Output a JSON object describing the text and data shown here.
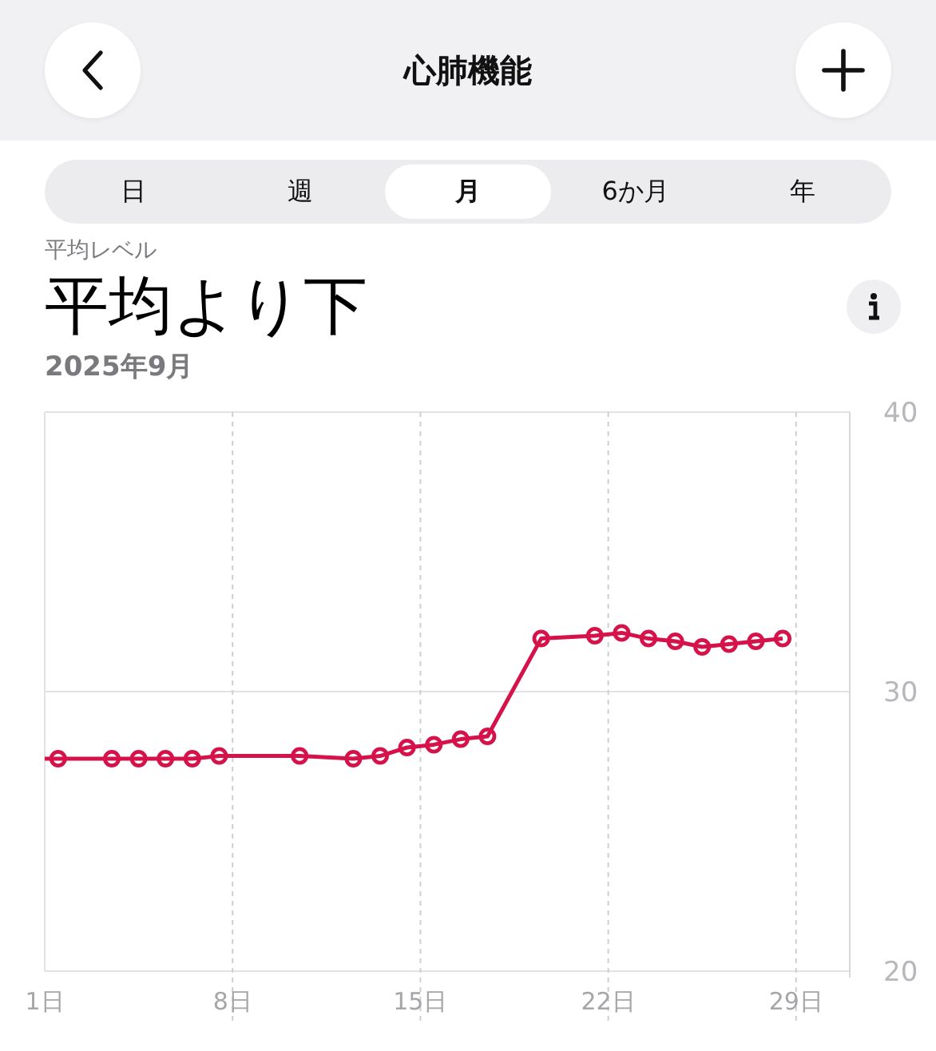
{
  "header": {
    "title": "心肺機能"
  },
  "tabs": [
    {
      "label": "日",
      "selected": false
    },
    {
      "label": "週",
      "selected": false
    },
    {
      "label": "月",
      "selected": true
    },
    {
      "label": "6か月",
      "selected": false
    },
    {
      "label": "年",
      "selected": false
    }
  ],
  "summary": {
    "caption": "平均レベル",
    "value": "平均より下",
    "period": "2025年9月"
  },
  "chart_data": {
    "type": "line",
    "x": [
      1,
      1.5,
      3.5,
      4.5,
      5.5,
      6.5,
      7.5,
      10.5,
      12.5,
      13.5,
      14.5,
      15.5,
      16.5,
      17.5,
      19.5,
      21.5,
      22.5,
      23.5,
      24.5,
      25.5,
      26.5,
      27.5,
      28.5
    ],
    "series": [
      {
        "color": "#d6124a",
        "marker": "circle",
        "values": [
          27.6,
          27.6,
          27.6,
          27.6,
          27.6,
          27.6,
          27.7,
          27.7,
          27.6,
          27.7,
          28.0,
          28.1,
          28.3,
          28.4,
          31.9,
          32.0,
          32.1,
          31.9,
          31.8,
          31.6,
          31.7,
          31.8,
          31.9
        ]
      }
    ],
    "grid": true,
    "ref_lines": [
      {
        "axis": "y",
        "value": 30
      }
    ],
    "xlim": [
      1,
      31
    ],
    "ylim": [
      20,
      40
    ],
    "xticks": [
      {
        "value": 1,
        "label": "1日"
      },
      {
        "value": 8,
        "label": "8日"
      },
      {
        "value": 15,
        "label": "15日"
      },
      {
        "value": 22,
        "label": "22日"
      },
      {
        "value": 29,
        "label": "29日"
      }
    ],
    "yticks": [
      20,
      30,
      40
    ]
  }
}
